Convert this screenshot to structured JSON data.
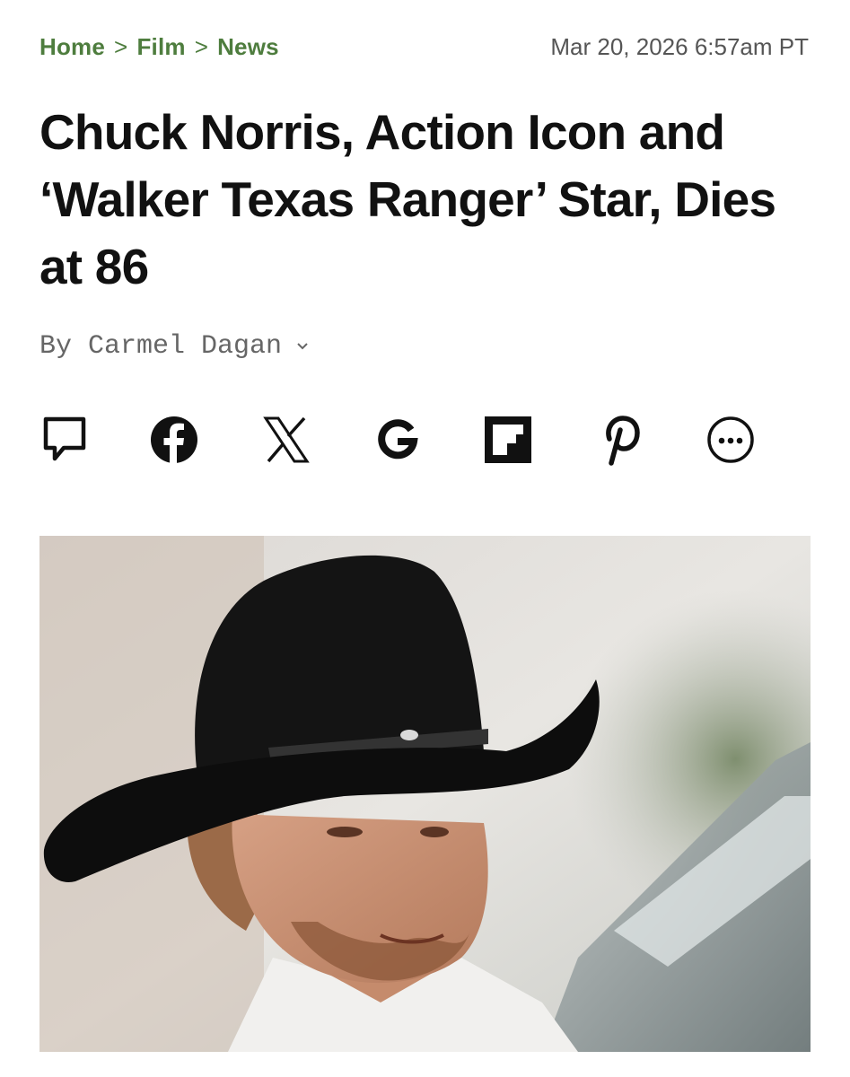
{
  "breadcrumb": {
    "items": [
      "Home",
      "Film",
      "News"
    ],
    "separator": ">"
  },
  "timestamp": "Mar 20, 2026 6:57am PT",
  "headline": "Chuck Norris, Action Icon and ‘Walker Texas Ranger’ Star, Dies at 86",
  "byline": {
    "prefix": "By",
    "author": "Carmel Dagan"
  },
  "share": {
    "icons": [
      "comment-icon",
      "facebook-icon",
      "x-icon",
      "google-icon",
      "flipboard-icon",
      "pinterest-icon",
      "more-icon"
    ]
  },
  "colors": {
    "breadcrumb": "#4e7d3e",
    "text": "#111111",
    "muted": "#666666"
  },
  "hero_image": {
    "subject": "man in black cowboy hat"
  }
}
